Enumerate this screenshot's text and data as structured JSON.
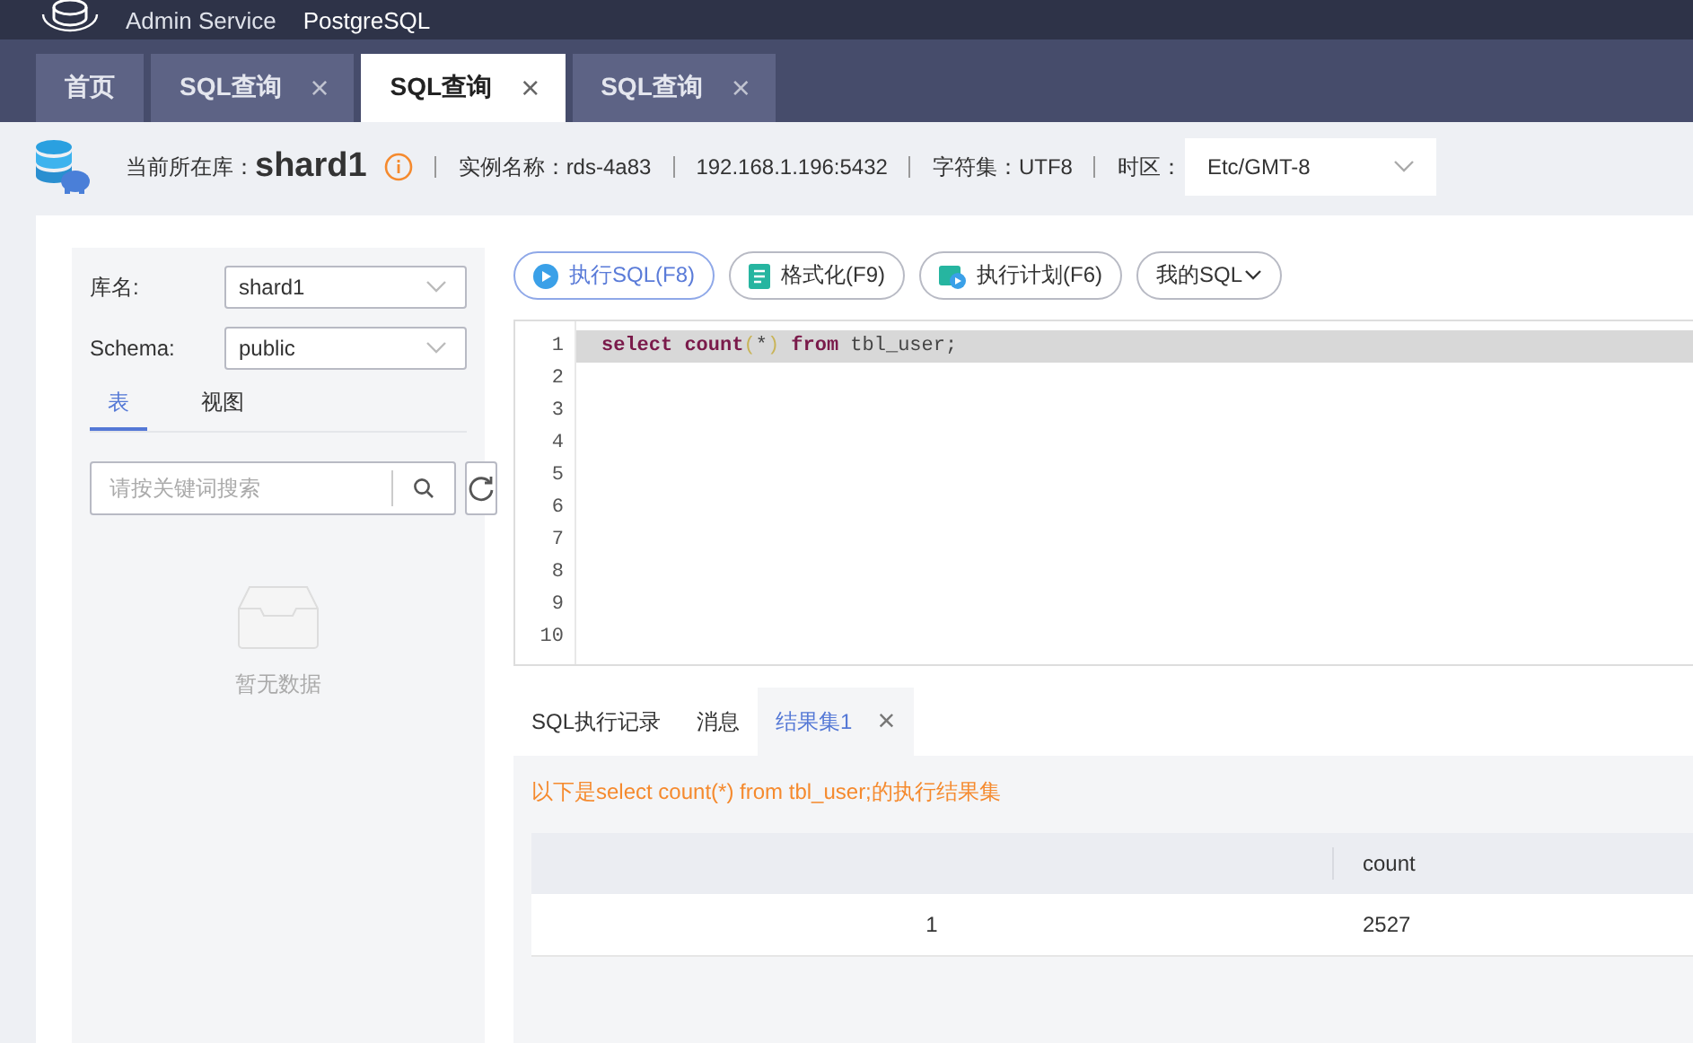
{
  "header": {
    "logo_lines": [
      "Admin Service"
    ],
    "product": "PostgreSQL"
  },
  "tabs": [
    {
      "label": "首页",
      "selected": false,
      "closable": false
    },
    {
      "label": "SQL查询",
      "selected": false,
      "closable": true
    },
    {
      "label": "SQL查询",
      "selected": true,
      "closable": true
    },
    {
      "label": "SQL查询",
      "selected": false,
      "closable": true
    }
  ],
  "close_glyph": "×",
  "info": {
    "db_label": "当前所在库：",
    "db": "shard1",
    "instance": "实例名称：rds-4a83",
    "address": "192.168.1.196:5432",
    "charset": "字符集：UTF8",
    "tz_label": "时区：",
    "tz_value": "Etc/GMT-8"
  },
  "sidebar": {
    "fields": [
      {
        "label": "库名:",
        "value": "shard1"
      },
      {
        "label": "Schema:",
        "value": "public"
      }
    ],
    "tabs": [
      {
        "label": "表",
        "selected": true
      },
      {
        "label": "视图",
        "selected": false
      }
    ],
    "search": {
      "placeholder": "请按关键词搜索"
    },
    "empty": "暂无数据"
  },
  "toolbar": [
    {
      "label": "执行SQL(F8)",
      "kind": "run"
    },
    {
      "label": "格式化(F9)",
      "kind": "format"
    },
    {
      "label": "执行计划(F6)",
      "kind": "plan"
    },
    {
      "label": "我的SQL",
      "kind": "menu"
    }
  ],
  "editor": {
    "line_numbers": [
      "1",
      "2",
      "3",
      "4",
      "5",
      "6",
      "7",
      "8",
      "9",
      "10"
    ],
    "code": [
      {
        "text": "select",
        "kind": "keyword"
      },
      {
        "text": " count",
        "kind": "keyword"
      },
      {
        "text": "(",
        "kind": "paren"
      },
      {
        "text": "*",
        "kind": "plain"
      },
      {
        "text": ")",
        "kind": "paren"
      },
      {
        "text": " from",
        "kind": "keyword"
      },
      {
        "text": " tbl_user;",
        "kind": "plain"
      }
    ]
  },
  "results": {
    "tabs": [
      {
        "label": "SQL执行记录",
        "selected": false,
        "closable": false
      },
      {
        "label": "消息",
        "selected": false,
        "closable": false
      },
      {
        "label": "结果集1",
        "selected": true,
        "closable": true
      }
    ],
    "message": "以下是select count(*) from tbl_user;的执行结果集",
    "table": {
      "columns": [
        "",
        "count"
      ],
      "rows": [
        [
          "1",
          "2527"
        ]
      ]
    }
  }
}
